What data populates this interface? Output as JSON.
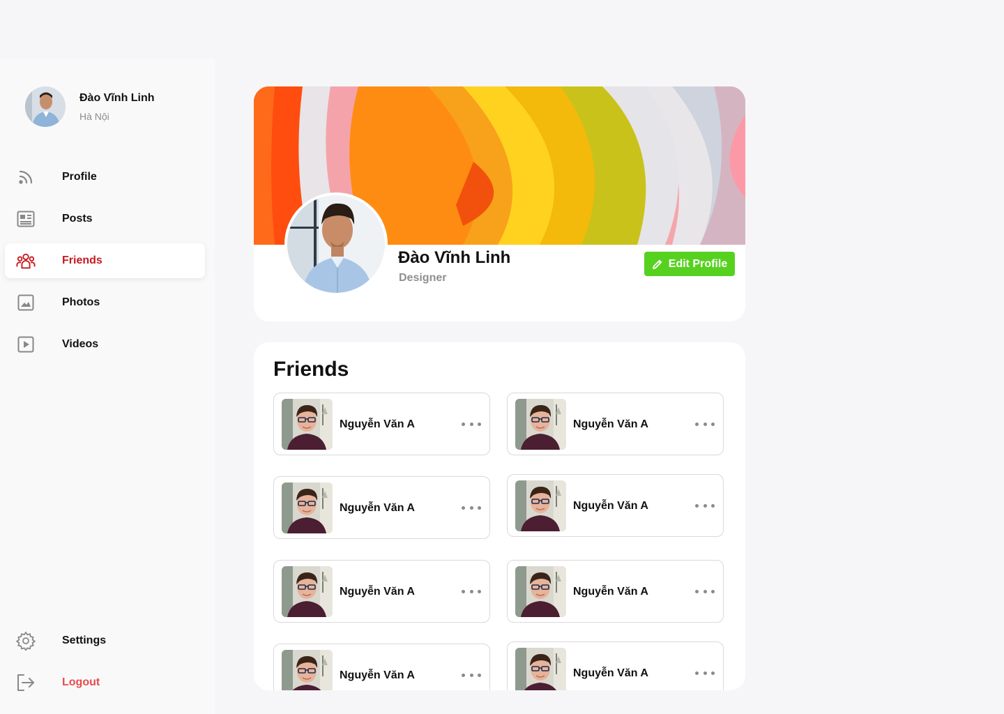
{
  "sidebar": {
    "user": {
      "name": "Đào Vĩnh Linh",
      "location": "Hà Nội"
    },
    "nav": [
      {
        "label": "Profile",
        "icon": "rss-icon"
      },
      {
        "label": "Posts",
        "icon": "newspaper-icon"
      },
      {
        "label": "Friends",
        "icon": "users-icon",
        "active": true
      },
      {
        "label": "Photos",
        "icon": "image-icon"
      },
      {
        "label": "Videos",
        "icon": "video-icon"
      }
    ],
    "settings_label": "Settings",
    "logout_label": "Logout"
  },
  "profile": {
    "name": "Đào Vĩnh Linh",
    "role": "Designer",
    "edit_label": "Edit Profile"
  },
  "friends": {
    "title": "Friends",
    "items": [
      {
        "name": "Nguyễn Văn A"
      },
      {
        "name": "Nguyễn Văn A"
      },
      {
        "name": "Nguyễn Văn A"
      },
      {
        "name": "Nguyễn Văn A"
      },
      {
        "name": "Nguyễn Văn A"
      },
      {
        "name": "Nguyễn Văn A"
      },
      {
        "name": "Nguyễn Văn A"
      },
      {
        "name": "Nguyễn Văn A"
      }
    ]
  },
  "colors": {
    "accent_red": "#c8181e",
    "logout_red": "#e84b4b",
    "edit_green": "#57d11f"
  }
}
